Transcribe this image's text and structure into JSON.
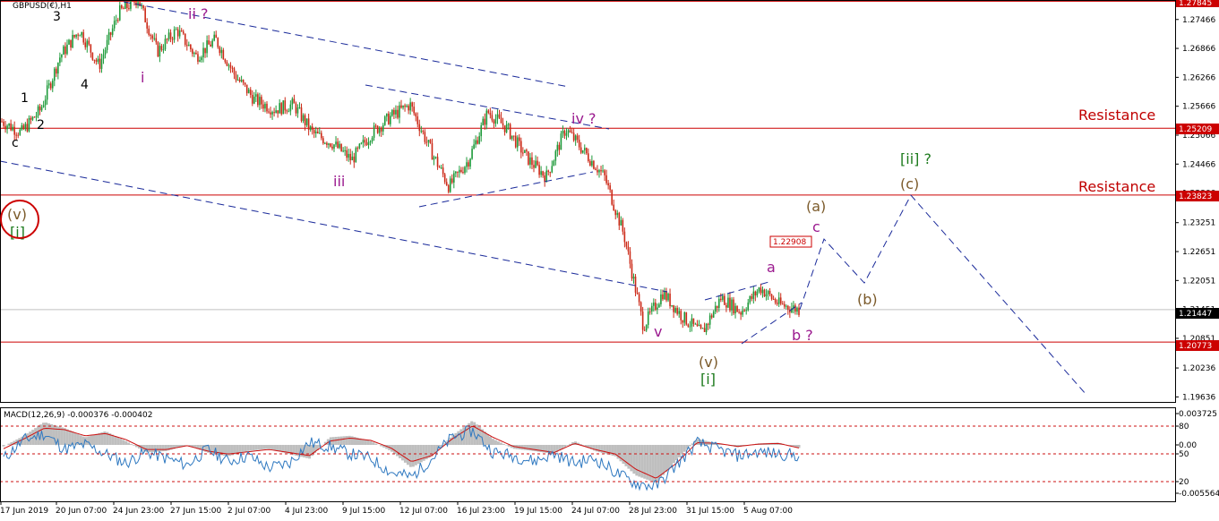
{
  "chart_data": [
    {
      "type": "line",
      "subtype": "candlestick",
      "title": "GBPUSD(€),H1",
      "ylim": [
        1.1955,
        1.2787
      ],
      "y_ticks": [
        "1.27466",
        "1.26866",
        "1.26266",
        "1.25666",
        "1.25066",
        "1.24466",
        "1.23866",
        "1.23251",
        "1.22651",
        "1.22051",
        "1.21451",
        "1.20851",
        "1.20236",
        "1.19636"
      ],
      "x_ticks": [
        "17 Jun 2019",
        "20 Jun 07:00",
        "24 Jun 23:00",
        "27 Jun 15:00",
        "2 Jul 07:00",
        "4 Jul 23:00",
        "9 Jul 15:00",
        "12 Jul 07:00",
        "16 Jul 23:00",
        "19 Jul 15:00",
        "24 Jul 07:00",
        "28 Jul 23:00",
        "31 Jul 15:00",
        "5 Aug 07:00"
      ],
      "price_path": [
        1.2535,
        1.2512,
        1.256,
        1.267,
        1.2725,
        1.265,
        1.276,
        1.279,
        1.268,
        1.2725,
        1.267,
        1.2705,
        1.263,
        1.258,
        1.256,
        1.257,
        1.251,
        1.249,
        1.2455,
        1.251,
        1.2545,
        1.257,
        1.248,
        1.24,
        1.2455,
        1.2555,
        1.252,
        1.246,
        1.242,
        1.252,
        1.247,
        1.242,
        1.23,
        1.211,
        1.218,
        1.213,
        1.2095,
        1.217,
        1.214,
        1.219,
        1.2155,
        1.2145
      ],
      "horizontal_levels": [
        {
          "value": "1.27845",
          "label": ""
        },
        {
          "value": "1.25209",
          "label": "Resistance"
        },
        {
          "value": "1.23823",
          "label": "Resistance"
        },
        {
          "value": "1.20773",
          "label": ""
        }
      ],
      "current_price": "1.21447",
      "target_price": "1.22908",
      "wave_labels": [
        {
          "text": "3",
          "color": "#000000"
        },
        {
          "text": "ii ?",
          "color": "#9b1a8f"
        },
        {
          "text": "1",
          "color": "#000000"
        },
        {
          "text": "4",
          "color": "#000000"
        },
        {
          "text": "i",
          "color": "#9b1a8f"
        },
        {
          "text": "2",
          "color": "#000000"
        },
        {
          "text": "c",
          "color": "#000000"
        },
        {
          "text": "iii",
          "color": "#9b1a8f"
        },
        {
          "text": "iv ?",
          "color": "#9b1a8f"
        },
        {
          "text": "v",
          "color": "#9b1a8f"
        },
        {
          "text": "(v)",
          "color": "#7b5a2a"
        },
        {
          "text": "[i]",
          "color": "#1e7b1e"
        },
        {
          "text": "(v)",
          "color": "#7b5a2a"
        },
        {
          "text": "[i]",
          "color": "#1e7b1e"
        },
        {
          "text": "a",
          "color": "#9b1a8f"
        },
        {
          "text": "b ?",
          "color": "#9b1a8f"
        },
        {
          "text": "c",
          "color": "#9b1a8f"
        },
        {
          "text": "(a)",
          "color": "#7b5a2a"
        },
        {
          "text": "(b)",
          "color": "#7b5a2a"
        },
        {
          "text": "(c)",
          "color": "#7b5a2a"
        },
        {
          "text": "[ii] ?",
          "color": "#1e7b1e"
        }
      ],
      "projection_path": [
        1.2145,
        1.2291,
        1.22,
        1.2382,
        1.197
      ],
      "colors": {
        "bull": "#1e9a3a",
        "bear": "#cc2a18",
        "resistance": "#cc0000",
        "trend": "#1a2a9a",
        "projection": "#1a2a9a"
      }
    },
    {
      "type": "line",
      "title": "MACD(12,26,9) -0.000376 -0.000402",
      "y_ticks": [
        "0.003725",
        "80",
        "0.00",
        "50",
        "20",
        "-0.005564"
      ],
      "series": [
        {
          "name": "",
          "values": [
            -0.0002,
            0.0012,
            0.003,
            0.0022,
            0.001,
            0.0018,
            0.0005,
            -0.001,
            -0.0008,
            0.0,
            -0.001,
            -0.0015,
            -0.0008,
            -0.0005,
            -0.0012,
            -0.0018,
            0.001,
            0.0012,
            0.0005,
            -0.0008,
            -0.003,
            -0.0015,
            0.0012,
            0.0032,
            0.0008,
            -0.0005,
            -0.0008,
            -0.0012,
            0.0005,
            -0.0008,
            -0.0015,
            -0.004,
            -0.005,
            -0.002,
            0.0008,
            0.0002,
            -0.0003,
            0.0002,
            0.0003,
            -0.0004
          ]
        },
        {
          "name": "",
          "values": [
            -0.0005,
            0.0008,
            0.0022,
            0.002,
            0.0012,
            0.0015,
            0.0007,
            -0.0006,
            -0.0006,
            -0.0001,
            -0.0008,
            -0.0012,
            -0.0009,
            -0.0006,
            -0.001,
            -0.0014,
            0.0005,
            0.0009,
            0.0006,
            -0.0004,
            -0.0022,
            -0.0014,
            0.0008,
            0.0025,
            0.001,
            -0.0002,
            -0.0006,
            -0.001,
            0.0002,
            -0.0006,
            -0.0012,
            -0.0032,
            -0.0044,
            -0.0024,
            0.0003,
            0.0002,
            -0.0002,
            0.0001,
            0.0002,
            -0.0004
          ]
        },
        {
          "name": "",
          "values": [
            45,
            65,
            72,
            55,
            60,
            50,
            40,
            52,
            45,
            38,
            55,
            42,
            48,
            35,
            40,
            62,
            58,
            50,
            45,
            30,
            25,
            45,
            68,
            75,
            52,
            48,
            42,
            50,
            40,
            45,
            30,
            18,
            15,
            38,
            62,
            55,
            48,
            52,
            50,
            48
          ]
        }
      ],
      "colors": {
        "histogram": "#bfbfbf",
        "signal": "#cc1111",
        "rsi": "#2e78c0",
        "levels": "#cc1111"
      }
    }
  ]
}
